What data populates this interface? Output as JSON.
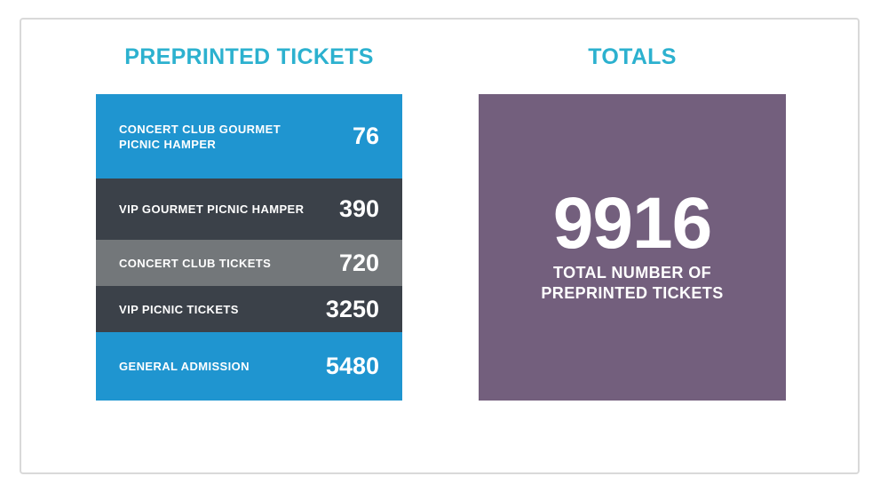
{
  "left_heading": "PREPRINTED TICKETS",
  "right_heading": "TOTALS",
  "tickets": [
    {
      "label": "CONCERT CLUB GOURMET PICNIC HAMPER",
      "value": "76"
    },
    {
      "label": "VIP GOURMET PICNIC HAMPER",
      "value": "390"
    },
    {
      "label": "CONCERT CLUB TICKETS",
      "value": "720"
    },
    {
      "label": "VIP PICNIC TICKETS",
      "value": "3250"
    },
    {
      "label": "GENERAL ADMISSION",
      "value": "5480"
    }
  ],
  "totals": {
    "number": "9916",
    "caption": "TOTAL NUMBER OF PREPRINTED TICKETS"
  },
  "colors": {
    "heading": "#2cb1cf",
    "blue_row": "#1f95d0",
    "dark_row": "#3b4149",
    "gray_row": "#73777a",
    "totals_bg": "#735f7d"
  }
}
